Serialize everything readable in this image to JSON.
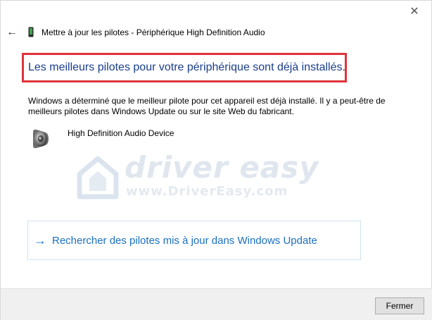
{
  "window": {
    "close_glyph": "✕",
    "back_glyph": "←",
    "title": "Mettre à jour les pilotes - Périphérique High Definition Audio"
  },
  "message": {
    "heading": "Les meilleurs pilotes pour votre périphérique sont déjà installés.",
    "description": "Windows a déterminé que le meilleur pilote pour cet appareil est déjà installé. Il y a peut-être de meilleurs pilotes dans Windows Update ou sur le site Web du fabricant.",
    "highlight_color": "#e0333b"
  },
  "device": {
    "name": "High Definition Audio Device",
    "icon": "speaker-icon"
  },
  "watermark": {
    "brand": "driver easy",
    "url": "www.DriverEasy.com"
  },
  "actions": {
    "windows_update_arrow": "→",
    "windows_update_label": "Rechercher des pilotes mis à jour dans Windows Update",
    "close_button_label": "Fermer"
  },
  "colors": {
    "heading_blue": "#1a3e8c",
    "link_blue": "#1a6fc1",
    "footer_bg": "#f0f0f0"
  }
}
